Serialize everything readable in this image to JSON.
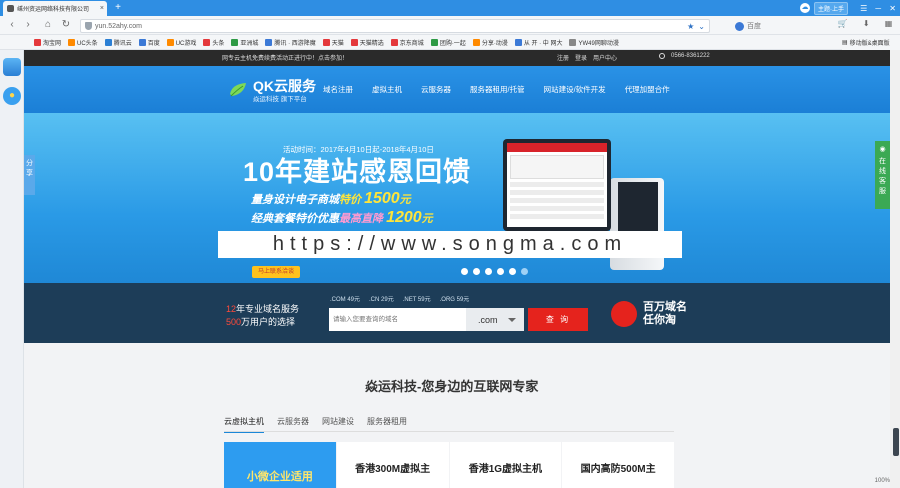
{
  "browser": {
    "tab_title": "嵊州资运网络科技有限公司",
    "tab_close": "×",
    "new_tab": "+",
    "url": "yun.52ahy.com",
    "skin_label": "主题·上手",
    "win_controls": [
      "☰",
      "─",
      "✕"
    ],
    "search_engine": "百度",
    "bookmarks": [
      "淘宝网",
      "UC头条",
      "腾讯云",
      "百度",
      "UC游戏",
      "头条",
      "亚洲城",
      "腾讯 · 西游降魔",
      "天猫",
      "天猫精选",
      "京东商城",
      "团购·一起",
      "分享·动漫",
      "从 开 · 中 网大",
      "YW49网聊动漫"
    ],
    "bookmark_right": "移动版&桌面版",
    "nav": {
      "back": "‹",
      "forward": "›",
      "refresh": "↻",
      "home": "⌂"
    }
  },
  "sidebar": {
    "share_label": "分享",
    "online_label": "在线客服"
  },
  "site": {
    "topstrip_left": "网专云主机免费续费活动正进行中！点击参加！",
    "topstrip_links": [
      "注册",
      "登录",
      "用户中心"
    ],
    "topstrip_phone": "0566-8361222",
    "logo_title": "QK云服务",
    "logo_sub": "焱运科技 旗下平台",
    "menu": [
      "域名注册",
      "虚拟主机",
      "云服务器",
      "服务器租用/托管",
      "网站建设/软件开发",
      "代理加盟合作"
    ],
    "banner": {
      "activity": "活动时间：2017年4月10日起-2018年4月10日",
      "title": "10年建站感恩回馈",
      "line1_pre": "量身设计电子商城",
      "line1_mid": "特价",
      "line1_price": "1500",
      "line1_unit": "元",
      "line2_pre": "经典套餐特价优惠",
      "line2_mid": "最高直降",
      "line2_price": "1200",
      "line2_unit": "元",
      "button": "马上联系洽谈",
      "watermark": "https://www.songma.com",
      "slide_count": 6,
      "active_slide": 6
    },
    "domain": {
      "slogan1_num": "12",
      "slogan1_text": "年专业域名服务",
      "slogan2_num": "500",
      "slogan2_text": "万用户的选择",
      "suffix_prices": [
        ".COM 49元",
        ".CN 29元",
        ".NET 59元",
        ".ORG 59元"
      ],
      "input_placeholder": "请输入您要查询的域名",
      "suffix_selected": ".com",
      "query_button": "查 询",
      "promo_line1": "百万域名",
      "promo_line2": "任你淘"
    },
    "section_title": "焱运科技-您身边的互联网专家",
    "tabs": [
      "云虚拟主机",
      "云服务器",
      "网站建设",
      "服务器租用"
    ],
    "cards": [
      "小微企业适用",
      "香港300M虚拟主",
      "香港1G虚拟主机",
      "国内高防500M主"
    ]
  },
  "status": {
    "zoom": "100%"
  }
}
